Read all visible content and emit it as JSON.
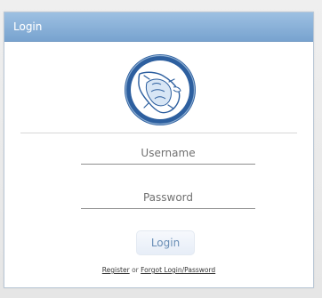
{
  "dialog": {
    "title": "Login"
  },
  "logo": {
    "icon": "sea-turtle-badge-icon",
    "colors": {
      "ring": "#2d5f9f",
      "inner": "#ffffff",
      "land": "#ffffff",
      "outline": "#2d5f9f"
    }
  },
  "form": {
    "username_placeholder": "Username",
    "password_placeholder": "Password",
    "login_button": "Login"
  },
  "links": {
    "register": "Register",
    "separator": "or",
    "forgot": "Forgot Login/Password"
  },
  "colors": {
    "titlebar": "#78a3cf",
    "button_text": "#6a8fb6"
  }
}
